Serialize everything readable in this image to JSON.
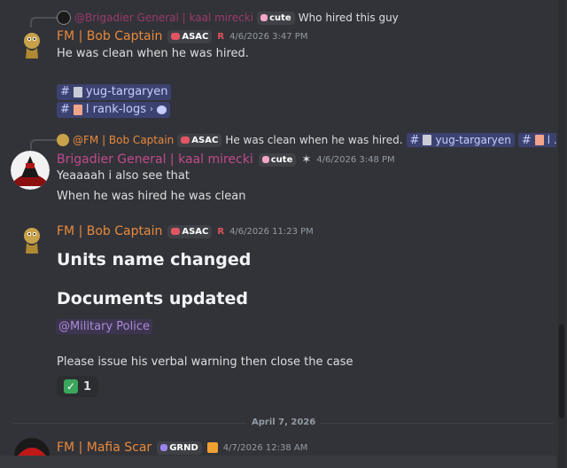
{
  "messages": {
    "reply1": {
      "author": "@Brigadier General | kaal mirecki",
      "tag": "cute",
      "text": "Who hired this guy"
    },
    "msg1": {
      "author": "FM | Bob Captain",
      "tag": "ASAC",
      "rank": "R",
      "timestamp": "4/6/2026 3:47 PM",
      "text": "He was clean when he was hired.",
      "channels": [
        {
          "name": "yug-targaryen"
        },
        {
          "name": "l rank-logs"
        }
      ]
    },
    "reply2": {
      "author": "@FM | Bob Captain",
      "tag": "ASAC",
      "text": "He was clean when he was hired.",
      "chan1": "yug-targaryen",
      "chan2": "l ..."
    },
    "msg2": {
      "author": "Brigadier General | kaal mirecki",
      "tag": "cute",
      "timestamp": "4/6/2026 3:48 PM",
      "line1": "Yeaaaah i also see that",
      "line2": "When he was hired he was clean"
    },
    "msg3": {
      "author": "FM | Bob Captain",
      "tag": "ASAC",
      "rank": "R",
      "timestamp": "4/6/2026 11:23 PM",
      "heading1": "Units name changed",
      "heading2": "Documents updated",
      "mention": "@Military Police",
      "text": "Please issue his verbal warning then close the case",
      "reaction_count": "1"
    },
    "divider": "April 7, 2026",
    "msg4": {
      "author": "FM | Mafia Scar",
      "tag": "GRND",
      "timestamp": "4/7/2026 12:38 AM"
    }
  },
  "colors": {
    "background": "#323339",
    "name_orange": "#e8893a",
    "name_pink": "#c04a8a",
    "channel_bg": "#3c4270",
    "mention_bg": "#3d3550"
  },
  "icons": [
    "reply-avatar-icon",
    "asac-tag-icon",
    "cute-heart-icon",
    "document-icon",
    "rank-logs-icon",
    "thread-bubble-icon",
    "check-mark-icon",
    "star-icon",
    "grnd-tag-icon"
  ]
}
